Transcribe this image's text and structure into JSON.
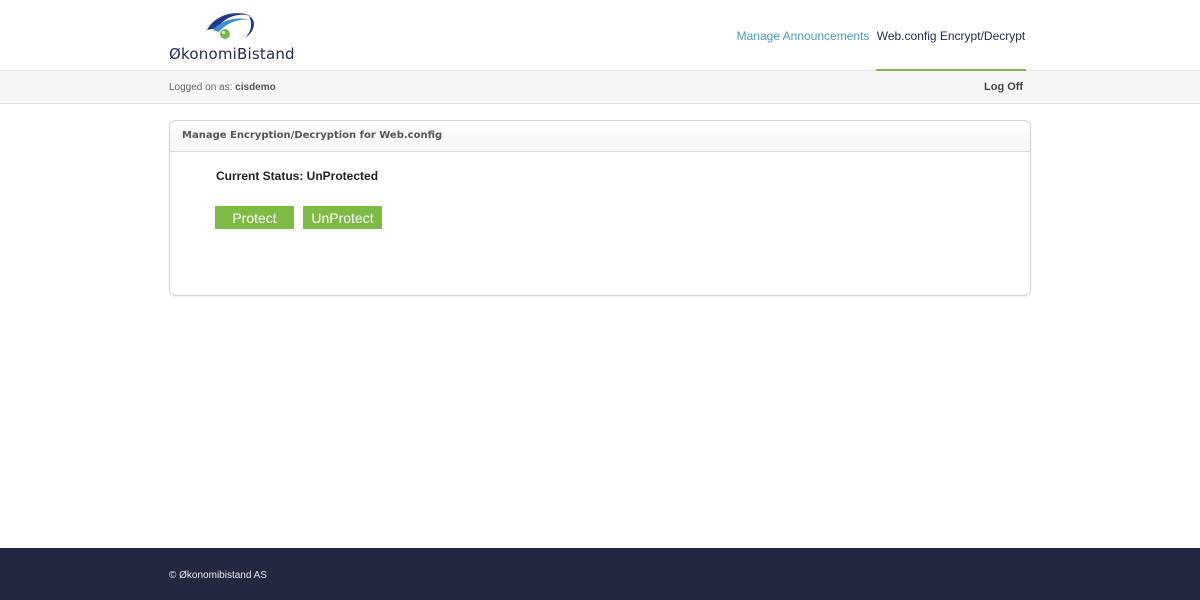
{
  "brand": {
    "name": "ØkonomiBistand",
    "icon": "eye-logo-icon",
    "colors": {
      "navy": "#1f2a55",
      "blue": "#2f7fc1",
      "green": "#7ab648"
    }
  },
  "nav": {
    "items": [
      {
        "label": "Manage Announcements",
        "active": false
      },
      {
        "label": "Web.config Encrypt/Decrypt",
        "active": true
      }
    ],
    "active_color": "#7ab648"
  },
  "session": {
    "logged_prefix": "Logged on as:",
    "username": "cisdemo",
    "logoff_label": "Log Off"
  },
  "panel": {
    "title": "Manage Encryption/Decryption for Web.config",
    "status_label": "Current Status: UnProtected",
    "buttons": {
      "protect": "Protect",
      "unprotect": "UnProtect",
      "color": "#7dbb45"
    }
  },
  "footer": {
    "copyright": "© Økonomibistand AS",
    "background": "#222840"
  }
}
